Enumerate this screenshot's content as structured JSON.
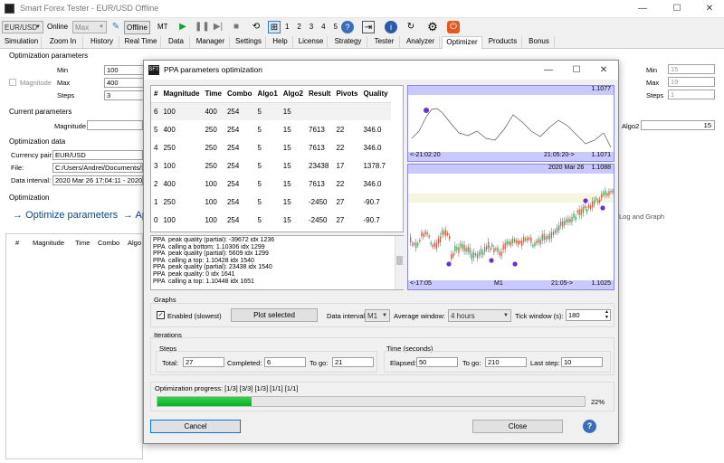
{
  "window": {
    "title": "Smart Forex Tester - EUR/USD Offline",
    "minimize": "—",
    "maximize": "☐",
    "close": "✕"
  },
  "toolbar": {
    "symbol": "EUR/USD",
    "online_label": "Online",
    "speed": "Max",
    "offline_button": "Offline",
    "mt_label": "MT",
    "speed_steps": [
      "1",
      "2",
      "3",
      "4",
      "5"
    ]
  },
  "tabs": [
    "Simulation",
    "Zoom In",
    "History",
    "Real Time",
    "Data",
    "Manager",
    "Settings",
    "Help",
    "License",
    "Strategy",
    "Tester",
    "Analyzer",
    "Optimizer",
    "Products",
    "Bonus"
  ],
  "active_tab": "Optimizer",
  "background": {
    "optimization_parameters": "Optimization parameters",
    "min_label": "Min",
    "min_value": "100",
    "magnitude_label": "Magnitude",
    "max_label": "Max",
    "max_value": "400",
    "steps_label": "Steps",
    "steps_value": "3",
    "right_min": "15",
    "right_max": "19",
    "right_steps": "1",
    "right_max_label": "Max",
    "right_steps_label": "Steps",
    "current_parameters": "Current parameters",
    "current_magnitude_label": "Magnitude",
    "algo2_label": "Algo2",
    "algo2_value": "15",
    "optimization_data": "Optimization data",
    "currency_pair_label": "Currency pair:",
    "currency_pair": "EUR/USD",
    "file_label": "File:",
    "file_value": "C:/Users/Andrei/Documents/S",
    "data_interval_label": "Data interval:",
    "data_interval": "2020 Mar 26 17:04:11 - 2020",
    "optimization_label": "Optimization",
    "optimize_link": "Optimize parameters",
    "ap_link": "Ap",
    "log_graph_link": "Log and Graph",
    "results_columns": [
      "#",
      "Magnitude",
      "Time",
      "Combo",
      "Algo"
    ]
  },
  "dialog": {
    "title": "PPA parameters optimization",
    "minimize": "—",
    "maximize": "☐",
    "close": "✕",
    "table": {
      "columns": [
        "#",
        "Magnitude",
        "Time",
        "Combo",
        "Algo1",
        "Algo2",
        "Result",
        "Pivots",
        "Quality"
      ],
      "rows": [
        [
          "6",
          "100",
          "400",
          "254",
          "5",
          "15",
          "",
          "",
          ""
        ],
        [
          "5",
          "400",
          "250",
          "254",
          "5",
          "15",
          "7613",
          "22",
          "346.0"
        ],
        [
          "4",
          "250",
          "250",
          "254",
          "5",
          "15",
          "7613",
          "22",
          "346.0"
        ],
        [
          "3",
          "100",
          "250",
          "254",
          "5",
          "15",
          "23438",
          "17",
          "1378.7"
        ],
        [
          "2",
          "400",
          "100",
          "254",
          "5",
          "15",
          "7613",
          "22",
          "346.0"
        ],
        [
          "1",
          "250",
          "100",
          "254",
          "5",
          "15",
          "-2450",
          "27",
          "-90.7"
        ],
        [
          "0",
          "100",
          "100",
          "254",
          "5",
          "15",
          "-2450",
          "27",
          "-90.7"
        ]
      ]
    },
    "log_lines": [
      "PPA  peak quality (partial): -39672 idx 1236",
      "PPA  calling a bottom: 1.10306 idx 1299",
      "PPA  peak quality (partial): 5609 idx 1299",
      "PPA  calling a top: 1.10428 idx 1540",
      "PPA  peak quality (partial): 23438 idx 1540",
      "PPA  peak quality: 0 idx 1641",
      "PPA  calling a top: 1.10448 idx 1651"
    ],
    "upper_chart": {
      "top_right": "1.1077",
      "left_time": "<-21:02:20",
      "right_time": "21:05:20->",
      "bottom_right": "1.1071"
    },
    "lower_chart": {
      "top_label": "2020 Mar 26",
      "top_right": "1.1088",
      "left_time": "<-17:05",
      "timeframe": "M1",
      "right_time": "21:05->",
      "bottom_right": "1.1025"
    },
    "graphs": {
      "group": "Graphs",
      "enabled_label": "Enabled (slowest)",
      "enabled": true,
      "plot_button": "Plot selected",
      "data_interval_label": "Data interval",
      "data_interval": "M1",
      "avg_window_label": "Average window:",
      "avg_window": "4 hours",
      "tick_window_label": "Tick window (s):",
      "tick_window": "180"
    },
    "iterations": {
      "group": "Iterations",
      "steps_group": "Steps",
      "total_label": "Total:",
      "total": "27",
      "completed_label": "Completed:",
      "completed": "6",
      "togo_label": "To go:",
      "togo": "21",
      "time_group": "Time (seconds)",
      "elapsed_label": "Elapsed:",
      "elapsed": "50",
      "time_togo_label": "To go:",
      "time_togo": "210",
      "last_step_label": "Last step:",
      "last_step": "10"
    },
    "progress": {
      "label": "Optimization progress: [1/3] [3/3] [1/3] [1/1] [1/1]",
      "percent_text": "22%",
      "fraction": 0.22
    },
    "cancel_button": "Cancel",
    "close_button": "Close",
    "help_icon": "?"
  },
  "colors": {
    "accent": "#0066cc",
    "progress": "#06b025",
    "selection": "#c9c9ff"
  }
}
